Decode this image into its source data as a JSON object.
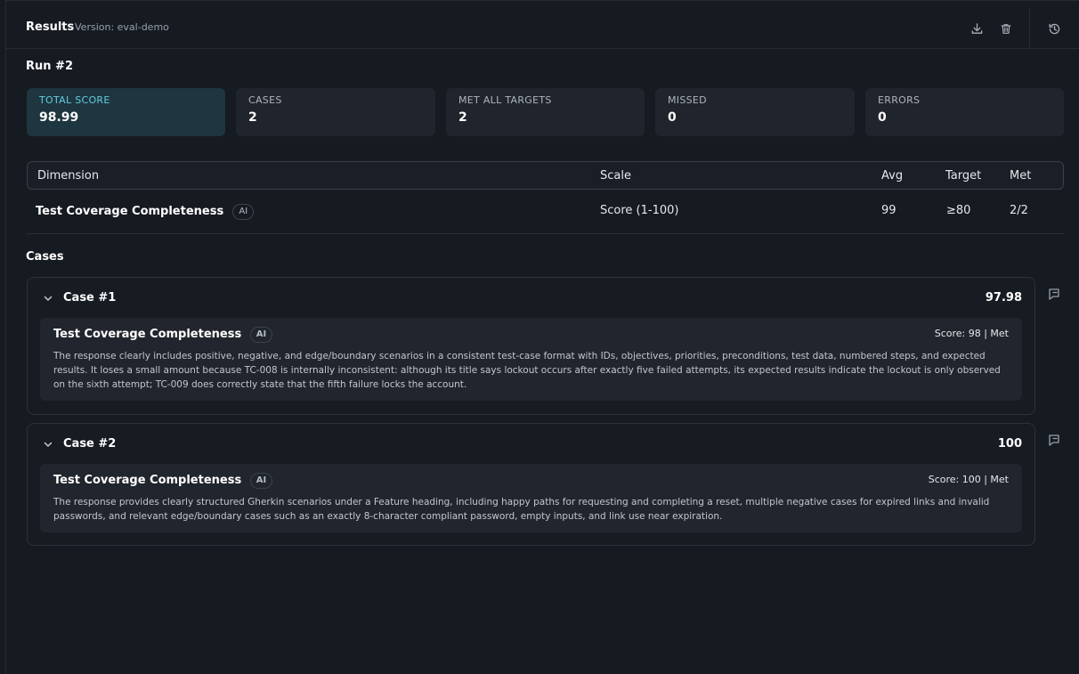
{
  "header": {
    "title": "Results",
    "version": "Version: eval-demo",
    "icons": [
      "download-icon",
      "trash-icon",
      "history-icon"
    ]
  },
  "run": {
    "title": "Run #2"
  },
  "stats": [
    {
      "label": "TOTAL SCORE",
      "value": "98.99"
    },
    {
      "label": "CASES",
      "value": "2"
    },
    {
      "label": "MET ALL TARGETS",
      "value": "2"
    },
    {
      "label": "MISSED",
      "value": "0"
    },
    {
      "label": "ERRORS",
      "value": "0"
    }
  ],
  "table": {
    "headers": [
      "Dimension",
      "Scale",
      "Avg",
      "Target",
      "Met"
    ],
    "rows": [
      {
        "dimension": "Test Coverage Completeness",
        "badge": "AI",
        "scale": "Score (1-100)",
        "avg": "99",
        "target": "≥80",
        "met": "2/2"
      }
    ]
  },
  "cases_section": {
    "title": "Cases",
    "cases": [
      {
        "name": "Case #1",
        "score": "97.98",
        "dimension": "Test Coverage Completeness",
        "badge": "AI",
        "meta": "Score: 98 | Met",
        "text": "The response clearly includes positive, negative, and edge/boundary scenarios in a consistent test-case format with IDs, objectives, priorities, preconditions, test data, numbered steps, and expected results. It loses a small amount because TC-008 is internally inconsistent: although its title says lockout occurs after exactly five failed attempts, its expected results indicate the lockout is only observed on the sixth attempt; TC-009 does correctly state that the fifth failure locks the account."
      },
      {
        "name": "Case #2",
        "score": "100",
        "dimension": "Test Coverage Completeness",
        "badge": "AI",
        "meta": "Score: 100 | Met",
        "text": "The response provides clearly structured Gherkin scenarios under a Feature heading, including happy paths for requesting and completing a reset, multiple negative cases for expired links and invalid passwords, and relevant edge/boundary cases such as an exactly 8-character compliant password, empty inputs, and link use near expiration."
      }
    ]
  },
  "colors": {
    "background": "#161a21",
    "card": "#20242d",
    "accent": "#63cbdc",
    "accent_bg": "#1e3640"
  }
}
